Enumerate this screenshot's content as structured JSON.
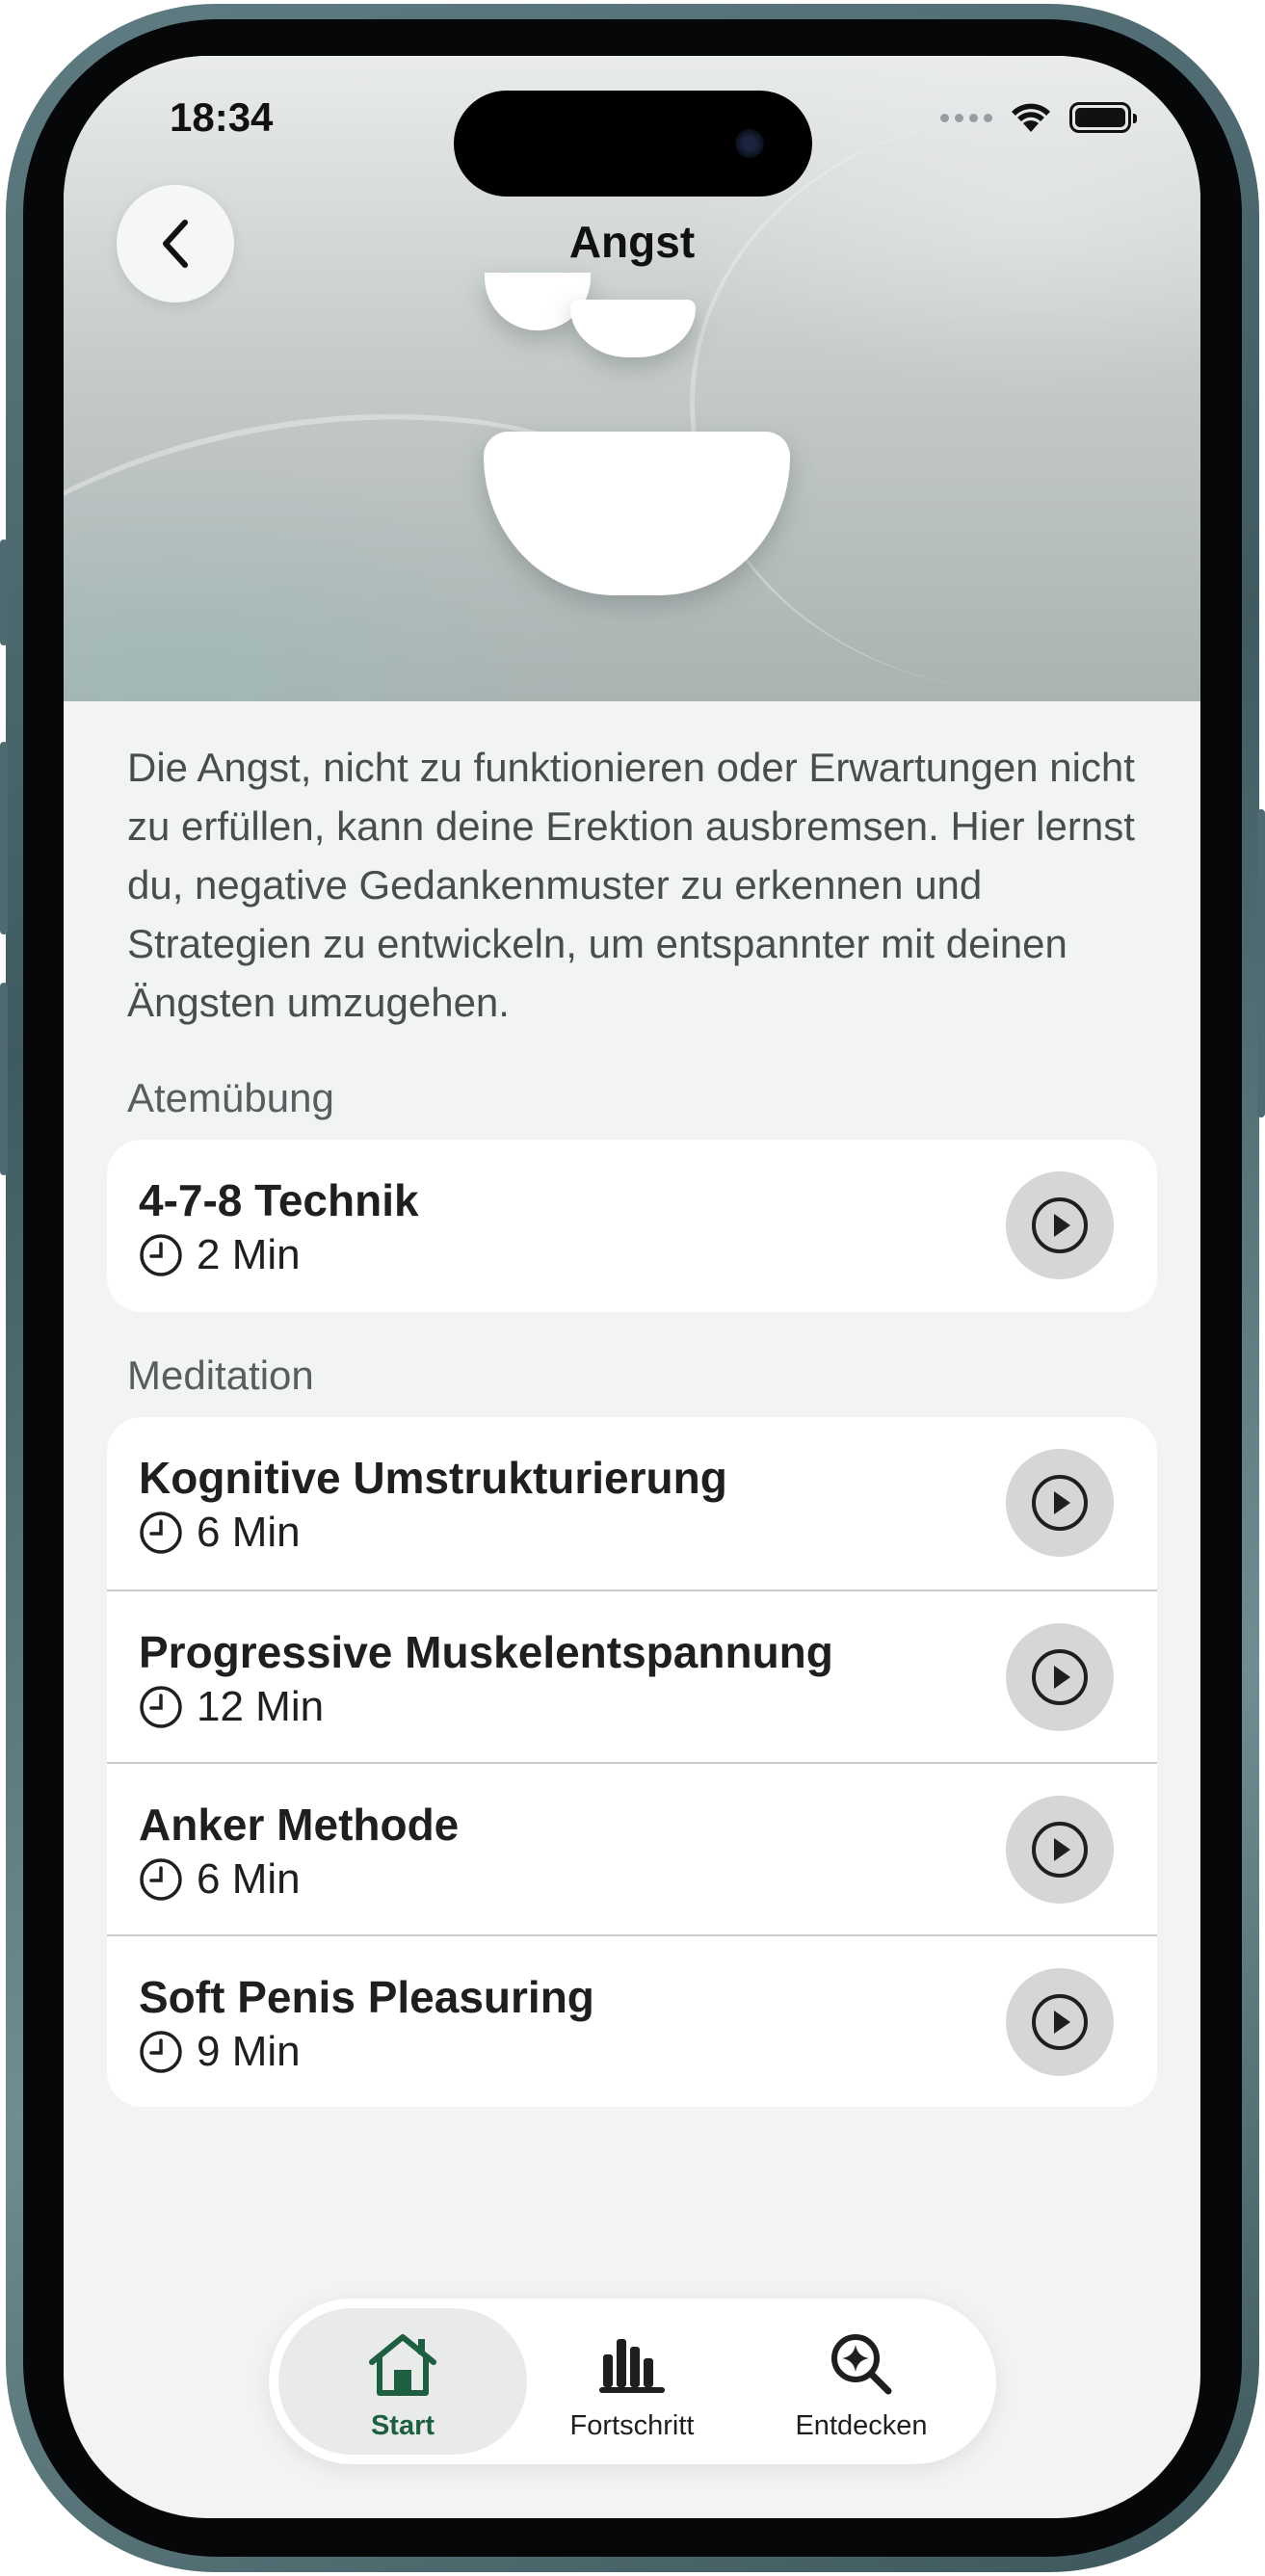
{
  "status_bar": {
    "time": "18:34"
  },
  "header": {
    "title": "Angst",
    "back_label": "Zurück"
  },
  "description": "Die Angst, nicht zu funktionieren oder Erwartungen nicht zu erfüllen, kann deine Erektion ausbremsen. Hier lernst du, negative Gedankenmuster zu erkennen und Strategien zu entwickeln, um entspannter mit deinen Ängsten umzugehen.",
  "sections": [
    {
      "label": "Atemübung",
      "items": [
        {
          "title": "4-7-8 Technik",
          "duration": "2 Min"
        }
      ]
    },
    {
      "label": "Meditation",
      "items": [
        {
          "title": "Kognitive Umstrukturierung",
          "duration": "6 Min"
        },
        {
          "title": "Progressive Muskelentspannung",
          "duration": "12 Min"
        },
        {
          "title": "Anker Methode",
          "duration": "6 Min"
        },
        {
          "title": "Soft Penis Pleasuring",
          "duration": "9 Min"
        }
      ]
    }
  ],
  "tabbar": {
    "active": "Start",
    "tabs": [
      {
        "label": "Start",
        "icon": "house-icon"
      },
      {
        "label": "Fortschritt",
        "icon": "bar-chart-icon"
      },
      {
        "label": "Entdecken",
        "icon": "sparkle-search-icon"
      }
    ]
  },
  "colors": {
    "accent": "#1e5f41",
    "background": "#f2f3f4",
    "card": "#ffffff",
    "play_button": "#d4d6d7"
  }
}
